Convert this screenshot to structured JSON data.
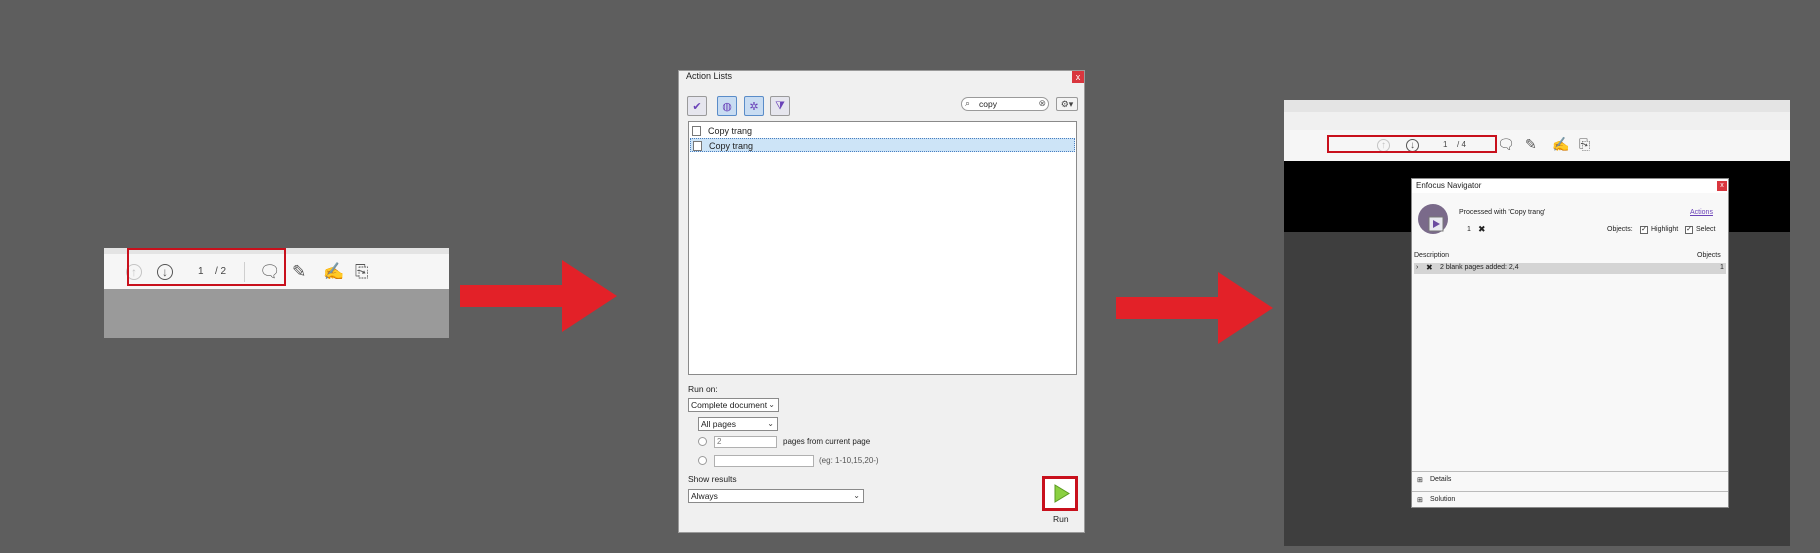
{
  "panel1": {
    "page_current": "1",
    "page_total": "/ 2",
    "highlight_color": "#c8101c"
  },
  "arrows": {
    "color": "#e32128"
  },
  "action_lists": {
    "title": "Action Lists",
    "close_label": "x",
    "search_value": "copy",
    "items": [
      {
        "label": "Copy trang",
        "selected": false
      },
      {
        "label": "Copy trang",
        "selected": true
      }
    ],
    "run_on_label": "Run on:",
    "scope_value": "Complete document",
    "pages_value": "All pages",
    "pages_count_value": "2",
    "pages_from_label": "pages from current page",
    "range_hint": "(eg: 1-10,15,20-)",
    "show_results_label": "Show results",
    "show_results_value": "Always",
    "run_label": "Run"
  },
  "panel3": {
    "page_current": "1",
    "page_total": "/ 4",
    "navigator": {
      "title": "Enfocus Navigator",
      "close_label": "x",
      "processed_text": "Processed with 'Copy trang'",
      "actions_link": "Actions",
      "count": "1",
      "objects_label": "Objects:",
      "highlight_label": "Highlight",
      "select_label": "Select",
      "col_description": "Description",
      "col_objects": "Objects",
      "row_text": "2 blank pages added: 2,4",
      "row_count": "1",
      "details_label": "Details",
      "solution_label": "Solution"
    }
  }
}
